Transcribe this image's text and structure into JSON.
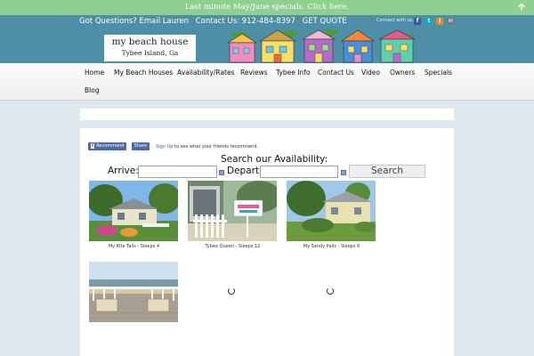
{
  "promo": {
    "text": "Last minute May/June specials. Click here."
  },
  "header": {
    "contact": [
      "Got Questions? Email Lauren",
      "Contact Us: 912-484-8397",
      "GET QUOTE"
    ],
    "connect_label": "Connect with us:",
    "logo_line1": "my beach house",
    "logo_line2": "Tybee Island, Ga"
  },
  "nav": {
    "items": [
      "Home",
      "My Beach Houses",
      "Availability/Rates",
      "Reviews",
      "Tybee Info",
      "Contact Us",
      "Video",
      "Owners",
      "Specials",
      "Blog"
    ]
  },
  "facebook": {
    "recommend_label": "Recommend",
    "share_label": "Share",
    "signup_link": "Sign Up",
    "signup_text": "to see what your friends recommend."
  },
  "search": {
    "title": "Search our Availability:",
    "arrive_label": "Arrive:",
    "depart_label": "Depart:",
    "button_label": "Search"
  },
  "properties": [
    {
      "caption": "My Kite Tails - Sleeps 4"
    },
    {
      "caption": "Tybee Queen - Sleeps 12"
    },
    {
      "caption": "My Sandy Pails - Sleeps 6"
    }
  ],
  "colors": {
    "promo": "#8fcf8f",
    "header": "#4e8ea6",
    "background": "#dfe8ec"
  }
}
